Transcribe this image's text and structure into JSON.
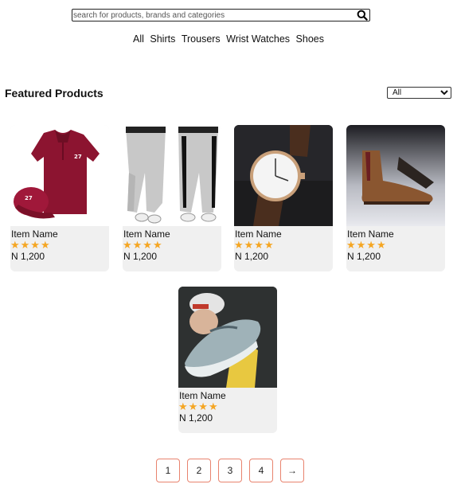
{
  "search": {
    "placeholder": "search for products, brands and categories",
    "icon": "search-icon"
  },
  "nav": {
    "items": [
      "All",
      "Shirts",
      "Trousers",
      "Wrist Watches",
      "Shoes"
    ]
  },
  "featured": {
    "title": "Featured Products",
    "filter_value": "All"
  },
  "products": [
    {
      "name": "Item Name",
      "price": "N 1,200",
      "rating": 4,
      "image": "red polo shirt and cap"
    },
    {
      "name": "Item Name",
      "price": "N 1,200",
      "rating": 4,
      "image": "grey jogger trousers"
    },
    {
      "name": "Item Name",
      "price": "N 1,200",
      "rating": 4,
      "image": "brown leather wrist watch"
    },
    {
      "name": "Item Name",
      "price": "N 1,200",
      "rating": 4,
      "image": "brown chelsea boot"
    },
    {
      "name": "Item Name",
      "price": "N 1,200",
      "rating": 4,
      "image": "person holding sneaker"
    }
  ],
  "pagination": {
    "pages": [
      "1",
      "2",
      "3",
      "4"
    ],
    "next": "→"
  },
  "colors": {
    "star": "#f5a623",
    "card_bg": "#f0f0f0",
    "pager_border": "#e8836e"
  }
}
